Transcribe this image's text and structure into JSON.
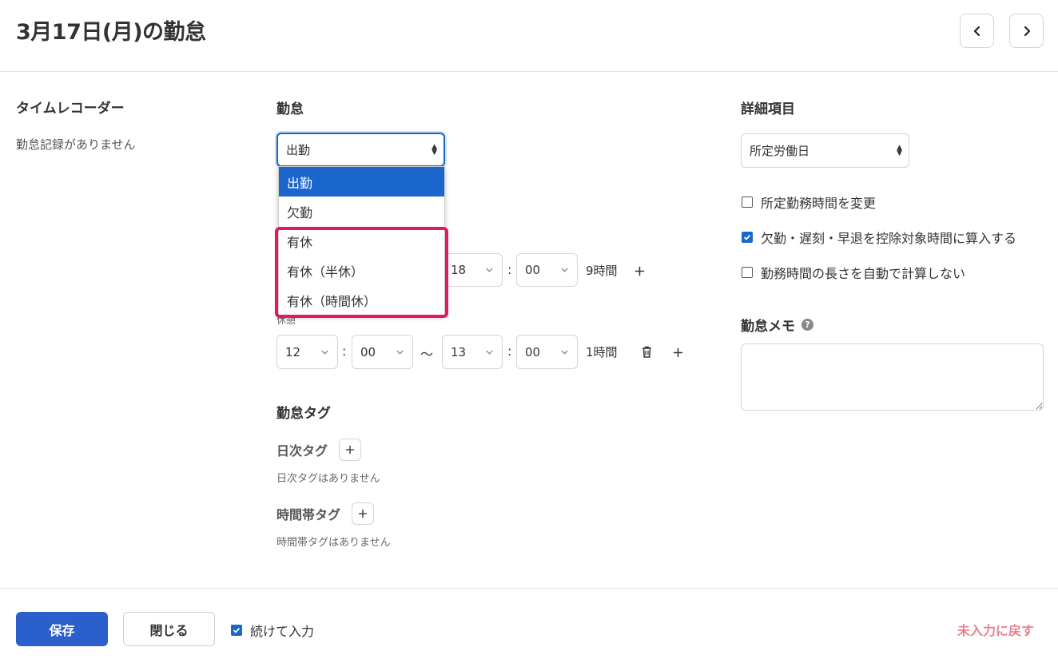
{
  "header": {
    "title": "3月17日(月)の勤怠"
  },
  "time_recorder": {
    "title": "タイムレコーダー",
    "empty_text": "勤怠記録がありません"
  },
  "attendance": {
    "title": "勤怠",
    "select_value": "出勤",
    "options": [
      "出勤",
      "欠勤",
      "有休",
      "有休（半休）",
      "有休（時間休）"
    ],
    "work_time": {
      "end_hour": "18",
      "end_minute": "00",
      "duration": "9時間"
    },
    "break": {
      "label": "休憩",
      "start_hour": "12",
      "start_minute": "00",
      "tilde": "〜",
      "end_hour": "13",
      "end_minute": "00",
      "duration": "1時間"
    },
    "colon": ":"
  },
  "tags": {
    "title": "勤怠タグ",
    "daily": {
      "label": "日次タグ",
      "empty_text": "日次タグはありません"
    },
    "time_band": {
      "label": "時間帯タグ",
      "empty_text": "時間帯タグはありません"
    }
  },
  "details": {
    "title": "詳細項目",
    "select_value": "所定労働日",
    "checkboxes": [
      {
        "label": "所定勤務時間を変更",
        "checked": false
      },
      {
        "label": "欠勤・遅刻・早退を控除対象時間に算入する",
        "checked": true
      },
      {
        "label": "勤務時間の長さを自動で計算しない",
        "checked": false
      }
    ]
  },
  "memo": {
    "title": "勤怠メモ"
  },
  "footer": {
    "save_label": "保存",
    "close_label": "閉じる",
    "continue_label": "続けて入力",
    "continue_checked": true,
    "reset_label": "未入力に戻す"
  },
  "colors": {
    "accent": "#1a66cc",
    "primary_button": "#2b5fcc",
    "highlight": "#e8165b",
    "reset_text": "#e8828f"
  }
}
